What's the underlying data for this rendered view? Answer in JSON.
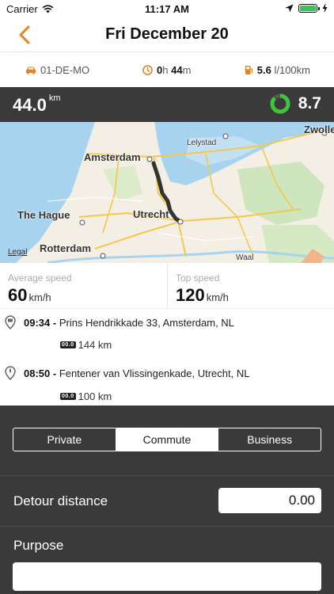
{
  "status_bar": {
    "carrier": "Carrier",
    "time": "11:17 AM"
  },
  "nav": {
    "title": "Fri December 20"
  },
  "trip_meta": {
    "plate": "01-DE-MO",
    "duration_h": "0",
    "duration_h_unit": "h",
    "duration_m": "44",
    "duration_m_unit": "m",
    "consumption_value": "5.6",
    "consumption_unit": "l/100km"
  },
  "distance_bar": {
    "distance": "44.0",
    "distance_unit": "km",
    "score": "8.7",
    "score_fraction": 0.87
  },
  "map": {
    "labels": {
      "amsterdam": "Amsterdam",
      "the_hague": "The Hague",
      "rotterdam": "Rotterdam",
      "utrecht": "Utrecht",
      "lelystad": "Lelystad",
      "zwolle": "Zwolle",
      "waal": "Waal"
    },
    "legal": "Legal"
  },
  "speeds": {
    "average_label": "Average speed",
    "average_value": "60",
    "average_unit": "km/h",
    "top_label": "Top speed",
    "top_value": "120",
    "top_unit": "km/h"
  },
  "stops": [
    {
      "time": "09:34",
      "sep": " - ",
      "address": "Prins Hendrikkade 33, Amsterdam, NL",
      "odo_badge": "00.0",
      "odometer": "144 km"
    },
    {
      "time": "08:50",
      "sep": " - ",
      "address": "Fentener van Vlissingenkade, Utrecht, NL",
      "odo_badge": "00.0",
      "odometer": "100 km"
    }
  ],
  "trip_type": {
    "options": [
      "Private",
      "Commute",
      "Business"
    ],
    "selected": "Commute"
  },
  "detour": {
    "label": "Detour distance",
    "value": "0.00"
  },
  "purpose": {
    "label": "Purpose",
    "value": ""
  },
  "colors": {
    "accent": "#e8821e",
    "dark_panel": "#3a3a3a",
    "score_green": "#3ec43e"
  }
}
